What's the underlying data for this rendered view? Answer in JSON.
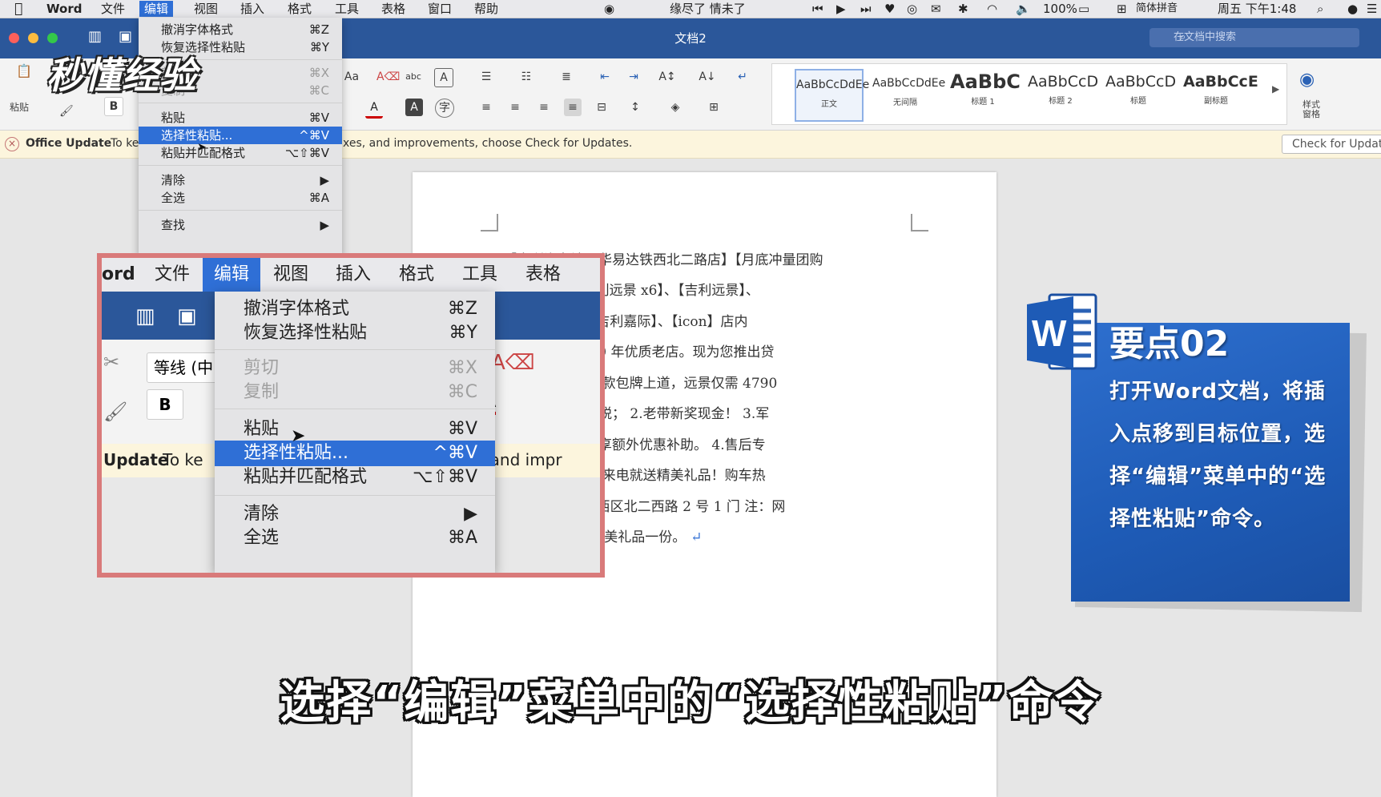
{
  "menubar": {
    "app": "Word",
    "items": [
      "文件",
      "编辑",
      "视图",
      "插入",
      "格式",
      "工具",
      "表格",
      "窗口",
      "帮助"
    ],
    "now_playing": "缘尽了 情未了",
    "battery": "100%",
    "input_method": "简体拼音",
    "clock": "周五 下午1:48"
  },
  "window": {
    "title": "文档2",
    "search_placeholder": "在文档中搜索"
  },
  "ribbon": {
    "paste_label": "粘贴",
    "bold_label": "B",
    "styles": [
      {
        "sample": "AaBbCcDdEe",
        "name": "正文"
      },
      {
        "sample": "AaBbCcDdEe",
        "name": "无间隔"
      },
      {
        "sample": "AaBbC",
        "name": "标题 1"
      },
      {
        "sample": "AaBbCcD",
        "name": "标题 2"
      },
      {
        "sample": "AaBbCcD",
        "name": "标题"
      },
      {
        "sample": "AaBbCcE",
        "name": "副标题"
      }
    ],
    "styles_pane_label": "样式窗格"
  },
  "update_bar": {
    "title": "Office Update",
    "message_prefix": "To ke",
    "message_suffix": "xes, and improvements, choose Check for Updates.",
    "button": "Check for Updat"
  },
  "edit_menu": {
    "items": [
      {
        "label": "撤消字体格式",
        "shortcut": "⌘Z"
      },
      {
        "label": "恢复选择性粘贴",
        "shortcut": "⌘Y"
      },
      {
        "label": "剪切",
        "shortcut": "⌘X"
      },
      {
        "label": "复制",
        "shortcut": "⌘C"
      },
      {
        "label": "粘贴",
        "shortcut": "⌘V"
      },
      {
        "label": "选择性粘贴...",
        "shortcut": "^⌘V"
      },
      {
        "label": "粘贴并匹配格式",
        "shortcut": "⌥⇧⌘V"
      },
      {
        "label": "清除",
        "shortcut": "▶"
      },
      {
        "label": "全选",
        "shortcut": "⌘A"
      },
      {
        "label": "查找",
        "shortcut": "▶"
      }
    ]
  },
  "watermark": "秒懂经验",
  "zoom_inset": {
    "menubar": [
      "ord",
      "文件",
      "编辑",
      "视图",
      "插入",
      "格式",
      "工具",
      "表格"
    ],
    "font_field": "等线 (中",
    "bold": "B",
    "update_prefix": "Update",
    "update_mid": "To ke",
    "update_suffix": "xes, and impr"
  },
  "document": {
    "lines": [
      "【吉利汽车沈阳华易达铁西北二路店】【月底冲量团购",
      "帝豪 GS】、【吉利远景 x6】、【吉利远景】、",
      "X3】、【缤瑞】【吉利嘉际】、【icon】店内",
      "吉利授权沈城 10 年优质老店。现为您推出贷",
      "如下： 1.一成车款包牌上道，远景仅需 4790",
      "送保险、送购置税； 2.老带新奖现金！ 3.军",
      "医护、公务员可享额外优惠补助。 4.售后专",
      "、用车无忧！ 5.来电就送精美礼品！购车热",
      "3539 地址：铁西区北二西路 2 号 1 门 注：网",
      "享 VIP 价并送精美礼品一份。"
    ],
    "paragraph_mark": "↵"
  },
  "key_point": {
    "logo_letter": "W",
    "title": "要点02",
    "text": "打开Word文档，将插入点移到目标位置，选择“编辑”菜单中的“选择性粘贴”命令。"
  },
  "subtitle": "选择“编辑”菜单中的“选择性粘贴”命令",
  "colors": {
    "word_blue": "#2b579a",
    "menu_highlight": "#2f6fd6",
    "inset_border": "#d97a7a",
    "card_blue": "#1e5bb6"
  }
}
